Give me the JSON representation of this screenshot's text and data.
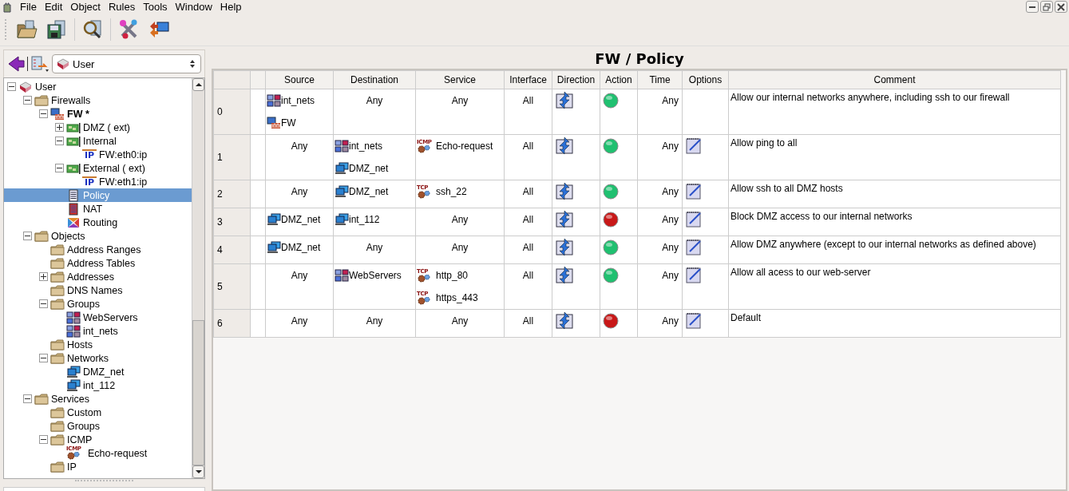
{
  "menu": [
    {
      "label": "File"
    },
    {
      "label": "Edit"
    },
    {
      "label": "Object"
    },
    {
      "label": "Rules"
    },
    {
      "label": "Tools"
    },
    {
      "label": "Window"
    },
    {
      "label": "Help"
    }
  ],
  "toolbar": [
    {
      "kind": "open"
    },
    {
      "kind": "save"
    },
    {
      "kind": "find"
    },
    {
      "kind": "compile"
    },
    {
      "kind": "install"
    }
  ],
  "library": {
    "value": "User"
  },
  "tree": [
    {
      "label": "User",
      "kind": "library",
      "expanded": true,
      "selected": false,
      "children": [
        {
          "label": "Firewalls",
          "kind": "folder",
          "expanded": true,
          "selected": false,
          "children": [
            {
              "label": "FW *",
              "kind": "firewall",
              "expanded": true,
              "selected": false,
              "children": [
                {
                  "label": "DMZ ( ext)",
                  "kind": "interface",
                  "expanded": false,
                  "selected": false
                },
                {
                  "label": "Internal",
                  "kind": "interface",
                  "expanded": true,
                  "selected": false,
                  "children": [
                    {
                      "label": "FW:eth0:ip",
                      "kind": "ip",
                      "badge": "IP",
                      "selected": false
                    }
                  ]
                },
                {
                  "label": "External ( ext)",
                  "kind": "interface",
                  "expanded": true,
                  "selected": false,
                  "children": [
                    {
                      "label": "FW:eth1:ip",
                      "kind": "ip",
                      "badge": "IP",
                      "selected": false
                    }
                  ]
                },
                {
                  "label": "Policy",
                  "kind": "policy",
                  "selected": true
                },
                {
                  "label": "NAT",
                  "kind": "nat",
                  "selected": false
                },
                {
                  "label": "Routing",
                  "kind": "routing",
                  "selected": false
                }
              ]
            }
          ]
        },
        {
          "label": "Objects",
          "kind": "folder",
          "expanded": true,
          "selected": false,
          "children": [
            {
              "label": "Address Ranges",
              "kind": "folder",
              "selected": false
            },
            {
              "label": "Address Tables",
              "kind": "folder",
              "selected": false
            },
            {
              "label": "Addresses",
              "kind": "folder",
              "expanded": false,
              "selected": false
            },
            {
              "label": "DNS Names",
              "kind": "folder",
              "selected": false
            },
            {
              "label": "Groups",
              "kind": "folder",
              "expanded": true,
              "selected": false,
              "children": [
                {
                  "label": "WebServers",
                  "kind": "group",
                  "selected": false
                },
                {
                  "label": "int_nets",
                  "kind": "group",
                  "selected": false
                }
              ]
            },
            {
              "label": "Hosts",
              "kind": "folder",
              "selected": false
            },
            {
              "label": "Networks",
              "kind": "folder",
              "expanded": true,
              "selected": false,
              "children": [
                {
                  "label": "DMZ_net",
                  "kind": "network",
                  "selected": false
                },
                {
                  "label": "int_112",
                  "kind": "network",
                  "selected": false
                }
              ]
            }
          ]
        },
        {
          "label": "Services",
          "kind": "folder",
          "expanded": true,
          "selected": false,
          "children": [
            {
              "label": "Custom",
              "kind": "folder",
              "selected": false
            },
            {
              "label": "Groups",
              "kind": "folder",
              "selected": false
            },
            {
              "label": "ICMP",
              "kind": "folder",
              "expanded": true,
              "selected": false,
              "children": [
                {
                  "label": "Echo-request",
                  "kind": "icmp",
                  "badge": "ICMP",
                  "selected": false
                }
              ]
            },
            {
              "label": "IP",
              "kind": "folder",
              "selected": false
            }
          ]
        }
      ]
    }
  ],
  "policy": {
    "title": "FW / Policy",
    "columns": [
      "Source",
      "Destination",
      "Service",
      "Interface",
      "Direction",
      "Action",
      "Time",
      "Options",
      "Comment"
    ],
    "rows": [
      {
        "number": "0",
        "source": [
          {
            "kind": "group",
            "label": "int_nets"
          },
          {
            "kind": "firewall",
            "label": "FW"
          }
        ],
        "destination": [
          {
            "kind": "any",
            "label": "Any"
          }
        ],
        "service": [
          {
            "kind": "any",
            "label": "Any"
          }
        ],
        "interface": "All",
        "allowed": true,
        "time": "Any",
        "options": false,
        "comment": "Allow our internal networks anywhere, including ssh to our firewall"
      },
      {
        "number": "1",
        "source": [
          {
            "kind": "any",
            "label": "Any"
          }
        ],
        "destination": [
          {
            "kind": "group",
            "label": "int_nets"
          },
          {
            "kind": "network",
            "label": "DMZ_net"
          }
        ],
        "service": [
          {
            "kind": "icmp",
            "badge": "ICMP",
            "label": "Echo-request"
          }
        ],
        "interface": "All",
        "allowed": true,
        "time": "Any",
        "options": true,
        "comment": "Allow ping to all"
      },
      {
        "number": "2",
        "source": [
          {
            "kind": "any",
            "label": "Any"
          }
        ],
        "destination": [
          {
            "kind": "network",
            "label": "DMZ_net"
          }
        ],
        "service": [
          {
            "kind": "tcp",
            "badge": "TCP",
            "label": "ssh_22"
          }
        ],
        "interface": "All",
        "allowed": true,
        "time": "Any",
        "options": true,
        "comment": "Allow ssh to all DMZ hosts"
      },
      {
        "number": "3",
        "source": [
          {
            "kind": "network",
            "label": "DMZ_net"
          }
        ],
        "destination": [
          {
            "kind": "network",
            "label": "int_112"
          }
        ],
        "service": [
          {
            "kind": "any",
            "label": "Any"
          }
        ],
        "interface": "All",
        "allowed": false,
        "time": "Any",
        "options": true,
        "comment": "Block DMZ access to our internal networks"
      },
      {
        "number": "4",
        "source": [
          {
            "kind": "network",
            "label": "DMZ_net"
          }
        ],
        "destination": [
          {
            "kind": "any",
            "label": "Any"
          }
        ],
        "service": [
          {
            "kind": "any",
            "label": "Any"
          }
        ],
        "interface": "All",
        "allowed": true,
        "time": "Any",
        "options": true,
        "comment": "Allow DMZ anywhere (except to our internal networks as defined above)"
      },
      {
        "number": "5",
        "source": [
          {
            "kind": "any",
            "label": "Any"
          }
        ],
        "destination": [
          {
            "kind": "group",
            "label": "WebServers"
          }
        ],
        "service": [
          {
            "kind": "tcp",
            "badge": "TCP",
            "label": "http_80"
          },
          {
            "kind": "tcp",
            "badge": "TCP",
            "label": "https_443"
          }
        ],
        "interface": "All",
        "allowed": true,
        "time": "Any",
        "options": true,
        "comment": "Allow all acess to our web-server"
      },
      {
        "number": "6",
        "source": [
          {
            "kind": "any",
            "label": "Any"
          }
        ],
        "destination": [
          {
            "kind": "any",
            "label": "Any"
          }
        ],
        "service": [
          {
            "kind": "any",
            "label": "Any"
          }
        ],
        "interface": "All",
        "allowed": false,
        "time": "Any",
        "options": true,
        "comment": "Default"
      }
    ]
  }
}
